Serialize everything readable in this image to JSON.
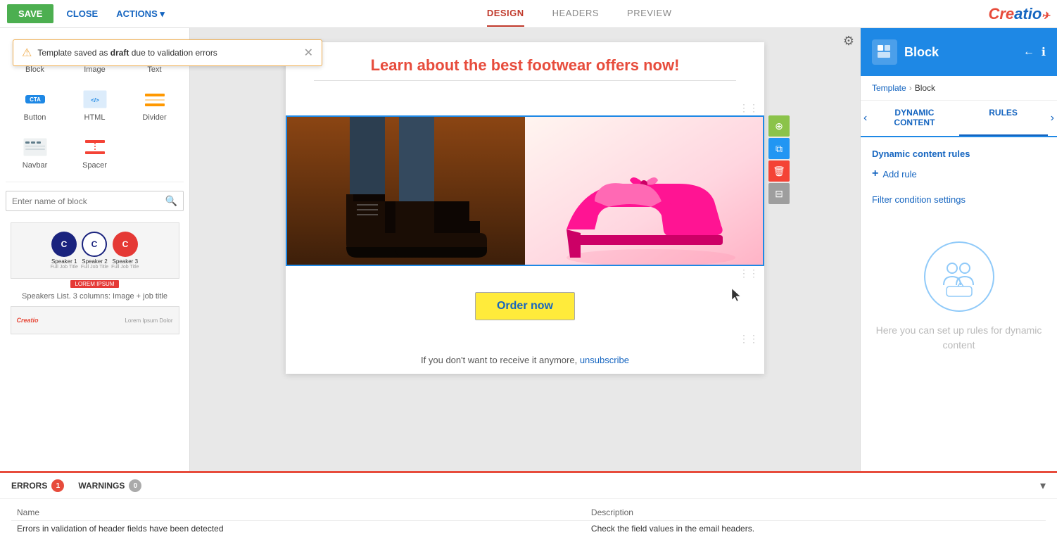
{
  "toolbar": {
    "save_label": "SAVE",
    "close_label": "CLOSE",
    "actions_label": "ACTIONS",
    "tabs": [
      {
        "id": "design",
        "label": "DESIGN",
        "active": true
      },
      {
        "id": "headers",
        "label": "HEADERS",
        "active": false
      },
      {
        "id": "preview",
        "label": "PREVIEW",
        "active": false
      }
    ]
  },
  "logo": {
    "text": "Creatio"
  },
  "notification": {
    "message": "Template saved as draft due to validation errors",
    "link_text": "draft"
  },
  "sidebar": {
    "blocks": [
      {
        "id": "block",
        "label": "Block",
        "icon": "block-icon"
      },
      {
        "id": "image",
        "label": "Image",
        "icon": "image-icon"
      },
      {
        "id": "text",
        "label": "Text",
        "icon": "text-icon"
      },
      {
        "id": "button",
        "label": "Button",
        "icon": "button-icon"
      },
      {
        "id": "html",
        "label": "HTML",
        "icon": "html-icon"
      },
      {
        "id": "divider",
        "label": "Divider",
        "icon": "divider-icon"
      },
      {
        "id": "navbar",
        "label": "Navbar",
        "icon": "navbar-icon"
      },
      {
        "id": "spacer",
        "label": "Spacer",
        "icon": "spacer-icon"
      }
    ],
    "search_placeholder": "Enter name of block",
    "speakers_thumb_label": "Speakers List. 3 columns: Image + job title"
  },
  "email": {
    "headline": "Learn about the best footwear offers now!",
    "cta_label": "Order now",
    "unsubscribe_text": "If you don't want to receive it anymore,",
    "unsubscribe_link": "unsubscribe"
  },
  "right_panel": {
    "title": "Block",
    "breadcrumb_root": "Template",
    "breadcrumb_current": "Block",
    "tabs": [
      {
        "id": "dynamic",
        "label": "DYNAMIC CONTENT",
        "active": false
      },
      {
        "id": "rules",
        "label": "RULES",
        "active": true
      }
    ],
    "rules_title": "Dynamic content rules",
    "add_rule_label": "Add rule",
    "filter_title": "Filter condition settings",
    "placeholder_text": "Here you can set up rules for dynamic content"
  },
  "errors_panel": {
    "errors_tab": "ERRORS",
    "errors_count": "1",
    "warnings_tab": "WARNINGS",
    "warnings_count": "0",
    "columns": [
      "Name",
      "Description"
    ],
    "rows": [
      {
        "name": "Errors in validation of header fields have been detected",
        "description": "Check the field values in the email headers."
      }
    ]
  },
  "speakers": [
    {
      "label": "Speaker 1",
      "sub": "Full Job Title",
      "color": "#1a237e"
    },
    {
      "label": "Speaker 2",
      "sub": "Full Job Title",
      "color": "#fff",
      "border": "#1a237e",
      "text_dark": true
    },
    {
      "label": "Speaker 3",
      "sub": "Full Job Title",
      "color": "#e53935"
    }
  ]
}
